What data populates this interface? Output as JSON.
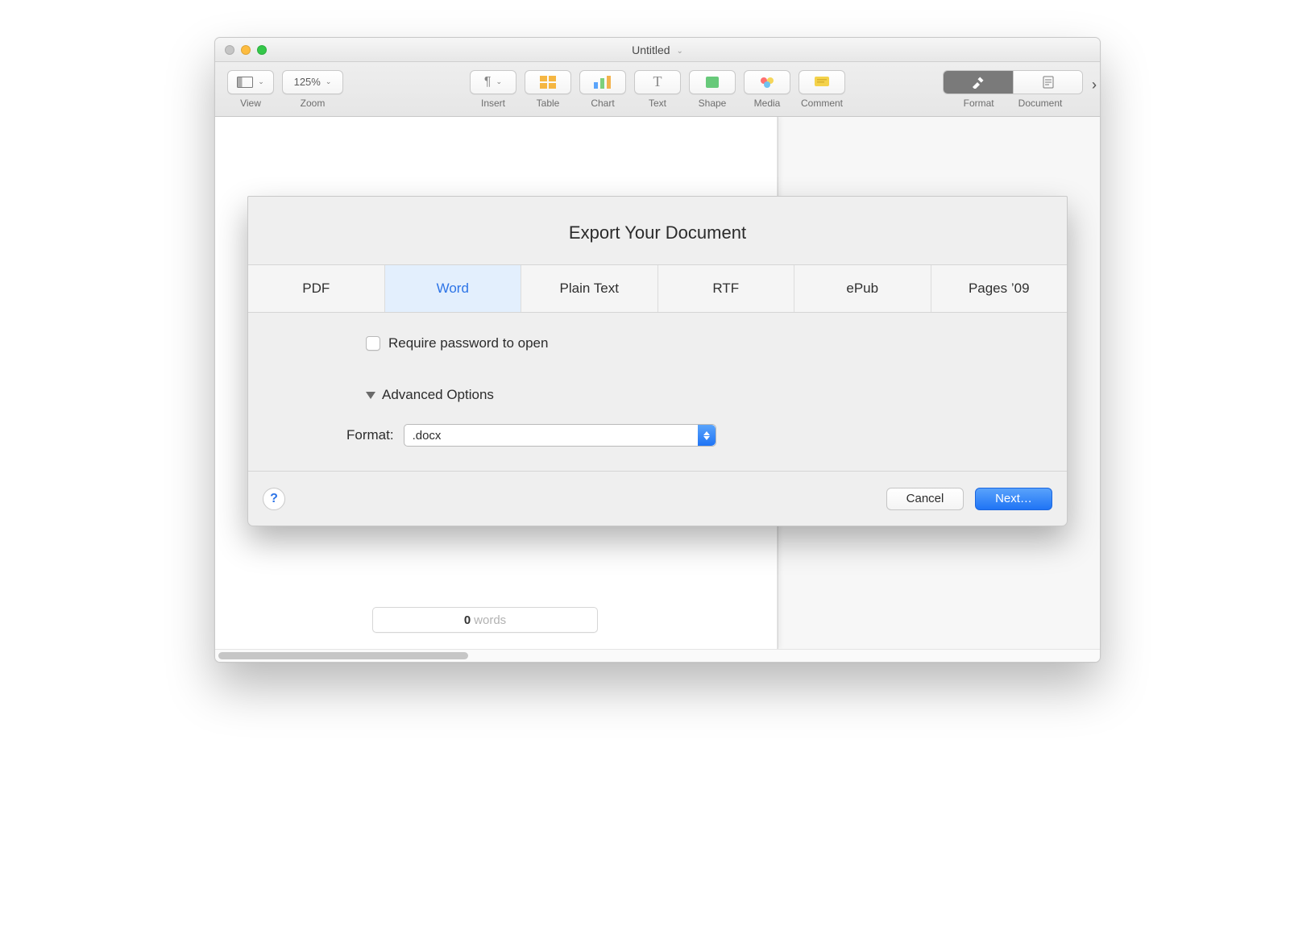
{
  "window": {
    "title": "Untitled"
  },
  "toolbar": {
    "view": {
      "label": "View"
    },
    "zoom": {
      "label": "Zoom",
      "value": "125%"
    },
    "insert": {
      "label": "Insert"
    },
    "table": {
      "label": "Table"
    },
    "chart": {
      "label": "Chart"
    },
    "text": {
      "label": "Text"
    },
    "shape": {
      "label": "Shape"
    },
    "media": {
      "label": "Media"
    },
    "comment": {
      "label": "Comment"
    },
    "format": {
      "label": "Format"
    },
    "document": {
      "label": "Document"
    }
  },
  "wordcount": {
    "count": "0",
    "unit": "words"
  },
  "sheet": {
    "title": "Export Your Document",
    "tabs": {
      "pdf": "PDF",
      "word": "Word",
      "plain": "Plain Text",
      "rtf": "RTF",
      "epub": "ePub",
      "pages09": "Pages ’09"
    },
    "require_password_label": "Require password to open",
    "advanced_label": "Advanced Options",
    "format_label": "Format:",
    "format_value": ".docx",
    "cancel": "Cancel",
    "next": "Next…",
    "help": "?"
  }
}
